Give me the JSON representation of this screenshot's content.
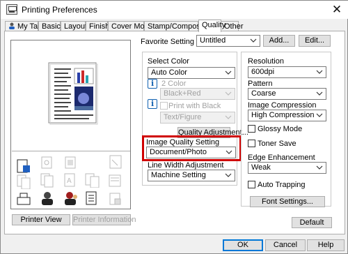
{
  "window": {
    "title": "Printing Preferences"
  },
  "tabs": [
    {
      "label": "My Tab"
    },
    {
      "label": "Basic"
    },
    {
      "label": "Layout"
    },
    {
      "label": "Finish"
    },
    {
      "label": "Cover Mode"
    },
    {
      "label": "Stamp/Composition"
    },
    {
      "label": "Quality",
      "active": true
    },
    {
      "label": "Other"
    }
  ],
  "favorite": {
    "label": "Favorite Setting",
    "value": "Untitled",
    "add_label": "Add...",
    "edit_label": "Edit..."
  },
  "color": {
    "select_color_label": "Select Color",
    "select_color_value": "Auto Color",
    "two_color_label": "2 Color",
    "two_color_value": "Black+Red",
    "print_with_black_label": "Print with Black",
    "print_with_black_value": "Text/Figure",
    "quality_adjustment_label": "Quality Adjustment..."
  },
  "image_quality": {
    "label": "Image Quality Setting",
    "value": "Document/Photo",
    "highlight_color": "#d00000"
  },
  "line_width": {
    "label": "Line Width Adjustment",
    "value": "Machine Setting"
  },
  "resolution": {
    "label": "Resolution",
    "value": "600dpi"
  },
  "pattern": {
    "label": "Pattern",
    "value": "Coarse"
  },
  "image_compression": {
    "label": "Image Compression",
    "value": "High Compression"
  },
  "glossy_mode": {
    "label": "Glossy Mode",
    "checked": false
  },
  "toner_save": {
    "label": "Toner Save",
    "checked": false
  },
  "edge_enhancement": {
    "label": "Edge Enhancement",
    "value": "Weak"
  },
  "auto_trapping": {
    "label": "Auto Trapping",
    "checked": false
  },
  "font_settings_label": "Font Settings...",
  "printer_view_label": "Printer View",
  "printer_information_label": "Printer Information",
  "default_label": "Default",
  "footer": {
    "ok": "OK",
    "cancel": "Cancel",
    "help": "Help"
  },
  "colors": {
    "accent": "#0078d7",
    "bar_red": "#cc2a2a",
    "bar_blue": "#2a3fa8",
    "bar_teal": "#2aa4b0"
  }
}
